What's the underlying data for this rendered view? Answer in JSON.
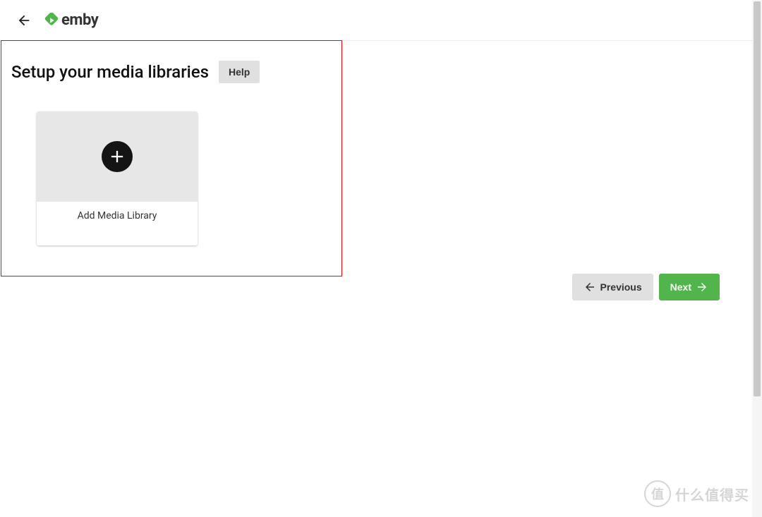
{
  "header": {
    "brand": "emby"
  },
  "page": {
    "title": "Setup your media libraries",
    "help_label": "Help"
  },
  "card": {
    "label": "Add Media Library"
  },
  "nav": {
    "previous": "Previous",
    "next": "Next"
  },
  "watermark": {
    "badge": "值",
    "text": "什么值得买"
  }
}
